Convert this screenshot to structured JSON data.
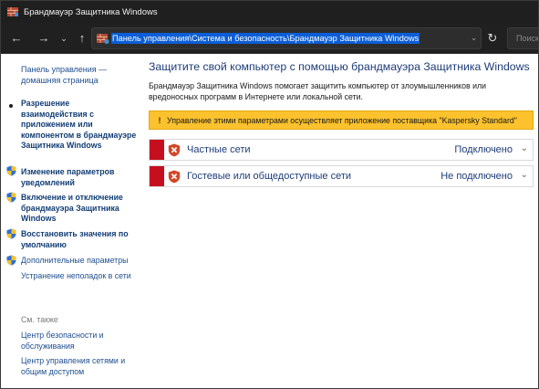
{
  "window": {
    "title": "Брандмауэр Защитника Windows"
  },
  "navigation": {
    "back_icon": "←",
    "forward_icon": "→",
    "recent_icon": "⌄",
    "up_icon": "↑",
    "address": "Панель управления\\Система и безопасность\\Брандмауэр Защитника Windows",
    "dropdown_icon": "⌄",
    "refresh_icon": "↻",
    "search_placeholder": "Поиск"
  },
  "sidebar": {
    "home": "Панель управления — домашняя страница",
    "items": [
      {
        "label": "Разрешение взаимодействия с приложением или компонентом в брандмауэре Защитника Windows",
        "style": "bold",
        "marker": "bullet"
      },
      {
        "label": "Изменение параметров уведомлений",
        "style": "bold",
        "marker": "shield"
      },
      {
        "label": "Включение и отключение брандмауэра Защитника Windows",
        "style": "bold",
        "marker": "shield"
      },
      {
        "label": "Восстановить значения по умолчанию",
        "style": "bold",
        "marker": "shield"
      },
      {
        "label": "Дополнительные параметры",
        "style": "link",
        "marker": "shield"
      },
      {
        "label": "Устранение неполадок в сети",
        "style": "link",
        "marker": "none"
      }
    ],
    "see_also_title": "См. также",
    "see_also": [
      "Центр безопасности и обслуживания",
      "Центр управления сетями и общим доступом"
    ]
  },
  "main": {
    "title": "Защитите свой компьютер с помощью брандмауэра Защитника Windows",
    "description": "Брандмауэр Защитника Windows помогает защитить компьютер от злоумышленников или вредоносных программ в Интернете или локальной сети.",
    "banner": {
      "icon": "!",
      "text": "Управление этими параметрами осуществляет приложение поставщика \"Kaspersky Standard\""
    },
    "networks": [
      {
        "name": "Частные сети",
        "status": "Подключено"
      },
      {
        "name": "Гостевые или общедоступные сети",
        "status": "Не подключено"
      }
    ]
  },
  "colors": {
    "title_bar": "#1f1f1f",
    "address_highlight": "#0b5ed7",
    "banner": "#fcc22d",
    "network_marker": "#c50f1f",
    "heading": "#1e3c78"
  }
}
